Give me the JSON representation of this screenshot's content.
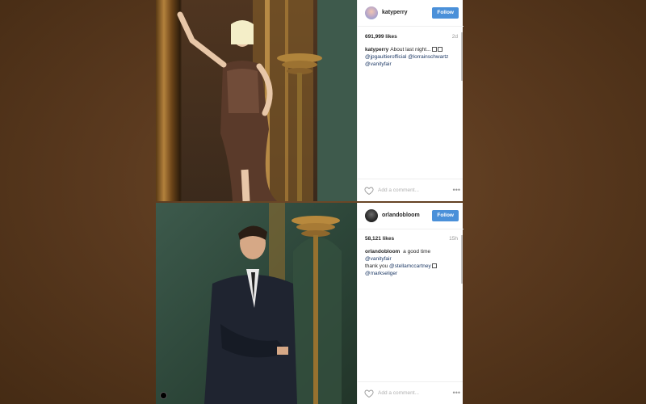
{
  "posts": [
    {
      "username": "katyperry",
      "follow_label": "Follow",
      "likes": "691,999 likes",
      "age": "2d",
      "caption_author": "katyperry",
      "caption_text": "About last night...",
      "caption_mentions": [
        "@jpgaultierofficial",
        "@lorrainschwartz",
        "@vanityfair"
      ],
      "comment_placeholder": "Add a comment...",
      "more_label": "•••"
    },
    {
      "username": "orlandobloom",
      "follow_label": "Follow",
      "likes": "58,121 likes",
      "age": "15h",
      "caption_author": "orlandobloom",
      "caption_text": "a good time",
      "caption_mention_1": "@vanityfair",
      "caption_text_2": "thank you",
      "caption_mention_2": "@stellamccartney",
      "caption_mention_3": "@markseliger",
      "comment_placeholder": "Add a comment...",
      "more_label": "•••"
    }
  ],
  "colors": {
    "background": "#5b3a1f",
    "follow_button": "#4a90d9",
    "mention": "#1e3a66"
  },
  "icons": [
    "avatar",
    "heart-icon",
    "more-options-icon",
    "instagram-glyph-icon"
  ]
}
